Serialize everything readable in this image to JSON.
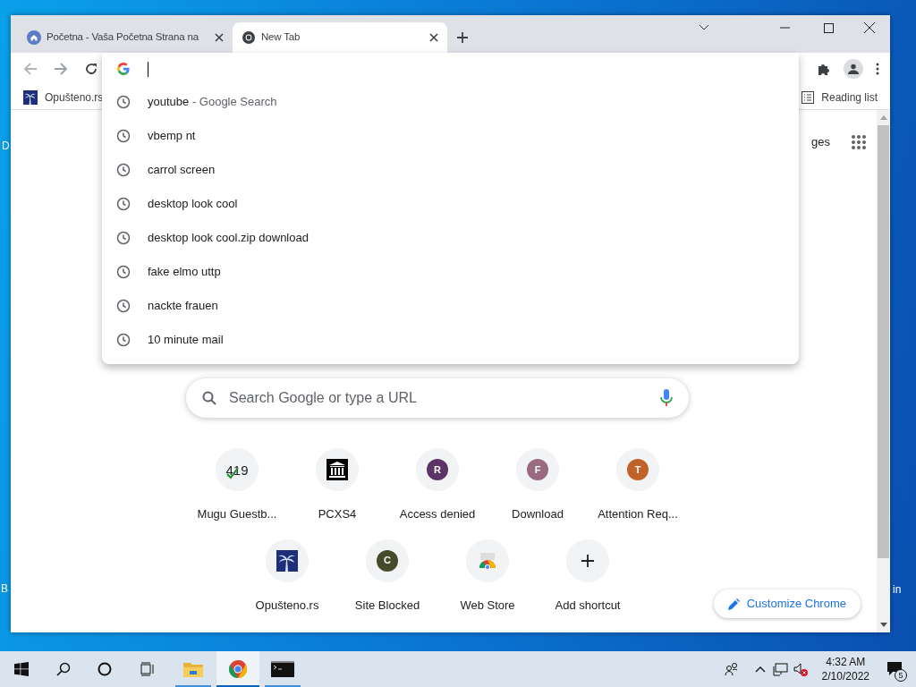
{
  "desktop": {
    "icon_labels": [
      "D",
      "B",
      "in"
    ]
  },
  "window": {
    "tabs": [
      {
        "title": "Početna - Vaša Početna Strana na",
        "kind": "site",
        "selected": false
      },
      {
        "title": "New Tab",
        "kind": "newtab",
        "selected": true
      }
    ],
    "bookmarks": [
      {
        "title": "Opušteno.rs"
      }
    ],
    "reading_list": "Reading list",
    "omnibox": {
      "suggestions": [
        {
          "query": "youtube",
          "suffix": "- Google Search"
        },
        {
          "query": "vbemp nt"
        },
        {
          "query": "carrol screen"
        },
        {
          "query": "desktop look cool"
        },
        {
          "query": "desktop look cool.zip download"
        },
        {
          "query": "fake elmo uttp"
        },
        {
          "query": "nackte frauen"
        },
        {
          "query": "10 minute mail"
        }
      ]
    },
    "page": {
      "images_link": "ges",
      "search": {
        "placeholder": "Search Google or type a URL"
      },
      "shortcuts": [
        {
          "title": "Mugu Guestb...",
          "kind": "counter",
          "badge": "419"
        },
        {
          "title": "PCXS4",
          "kind": "building"
        },
        {
          "title": "Access denied",
          "kind": "letter",
          "letter": "R",
          "color": "#5c3566"
        },
        {
          "title": "Download",
          "kind": "letter",
          "letter": "F",
          "color": "#9a6a80"
        },
        {
          "title": "Attention Req...",
          "kind": "letter",
          "letter": "T",
          "color": "#c0622a"
        },
        {
          "title": "Opušteno.rs",
          "kind": "palm"
        },
        {
          "title": "Site Blocked",
          "kind": "letter",
          "letter": "C",
          "color": "#474a2c"
        },
        {
          "title": "Web Store",
          "kind": "webstore"
        },
        {
          "title": "Add shortcut",
          "kind": "add"
        }
      ],
      "customize": "Customize Chrome"
    }
  },
  "taskbar": {
    "apps": [
      {
        "kind": "explorer",
        "active": false,
        "running": true
      },
      {
        "kind": "chrome",
        "active": true,
        "running": true
      },
      {
        "kind": "terminal",
        "active": false,
        "running": true
      }
    ],
    "time": "4:32 AM",
    "date": "2/10/2022",
    "notifications": "5"
  }
}
